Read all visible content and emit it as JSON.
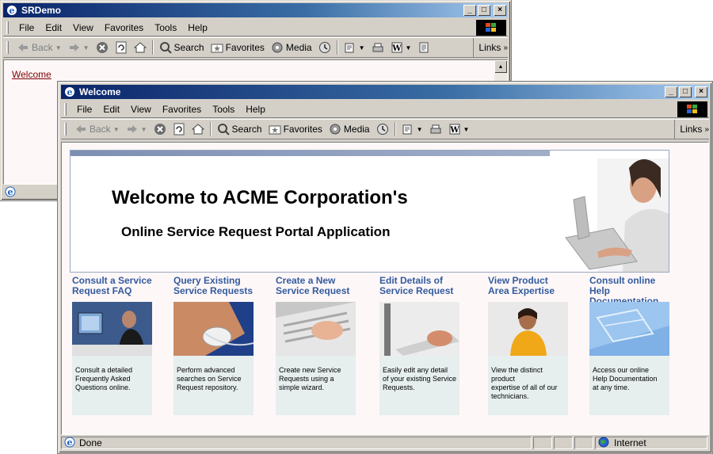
{
  "back_window": {
    "title": "SRDemo",
    "menu": [
      "File",
      "Edit",
      "View",
      "Favorites",
      "Tools",
      "Help"
    ],
    "toolbar": {
      "back": "Back",
      "search": "Search",
      "favorites": "Favorites",
      "media": "Media",
      "links": "Links"
    },
    "content_link": "Welcome"
  },
  "front_window": {
    "title": "Welcome",
    "menu": [
      "File",
      "Edit",
      "View",
      "Favorites",
      "Tools",
      "Help"
    ],
    "toolbar": {
      "back": "Back",
      "search": "Search",
      "favorites": "Favorites",
      "media": "Media",
      "links": "Links"
    },
    "status": {
      "text": "Done",
      "zone": "Internet"
    }
  },
  "banner": {
    "heading": "Welcome to ACME Corporation's",
    "subheading": "Online Service Request Portal Application"
  },
  "cards": [
    {
      "title_line1": "Consult a Service",
      "title_line2": "Request FAQ",
      "desc": [
        "Consult a detailed",
        "Frequently Asked",
        "Questions  online."
      ]
    },
    {
      "title_line1": "Query Existing",
      "title_line2": "Service Requests",
      "desc": [
        "Perform advanced",
        "searches on Service",
        "Request repository."
      ]
    },
    {
      "title_line1": "Create a New",
      "title_line2": "Service Request",
      "desc": [
        "Create new Service",
        "Requests using a",
        "simple wizard."
      ]
    },
    {
      "title_line1": "Edit Details of",
      "title_line2": "Service Request",
      "desc": [
        "Easily edit any detail",
        "of your existing Service",
        "Requests."
      ]
    },
    {
      "title_line1": "View Product",
      "title_line2": "Area Expertise",
      "desc": [
        "View the distinct product",
        "expertise of all of our",
        "technicians."
      ]
    },
    {
      "title_line1": "Consult online Help",
      "title_line2": "Documentation",
      "desc": [
        "Access our online",
        "Help Documentation",
        "at any time."
      ]
    }
  ],
  "colors": {
    "titlebar": "#0a246a",
    "card_title": "#335b9e",
    "link": "#800000",
    "chrome": "#d4d0c8"
  },
  "icons": [
    "ie-icon",
    "minimize-icon",
    "maximize-icon",
    "close-icon",
    "back-arrow-icon",
    "forward-arrow-icon",
    "stop-icon",
    "refresh-icon",
    "home-icon",
    "search-icon",
    "favorites-icon",
    "media-icon",
    "history-icon",
    "mail-icon",
    "print-icon",
    "edit-icon",
    "discuss-icon",
    "windows-logo-icon",
    "internet-zone-icon"
  ]
}
